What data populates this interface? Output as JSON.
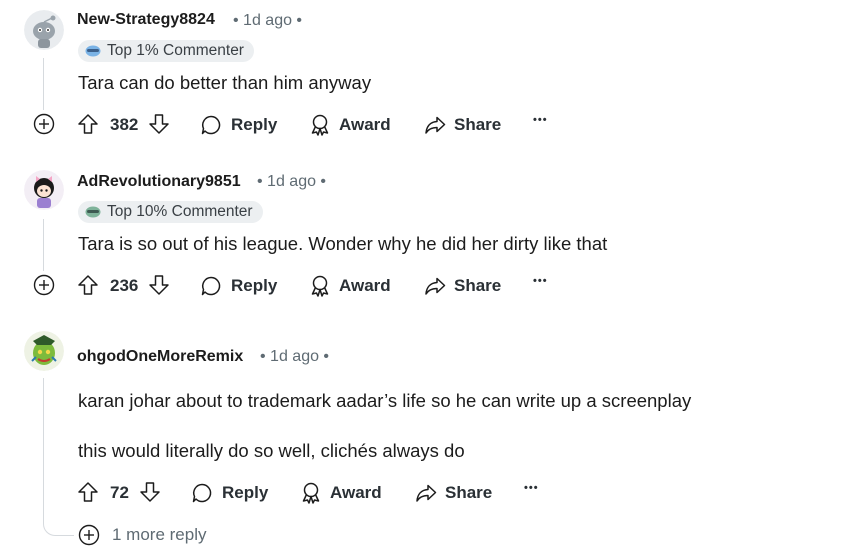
{
  "comments": [
    {
      "username": "New-Strategy8824",
      "time": "• 1d ago •",
      "badge": "Top 1% Commenter",
      "body": [
        "Tara can do better than him anyway"
      ],
      "votes": "382",
      "actions": {
        "reply": "Reply",
        "award": "Award",
        "share": "Share",
        "more": "•••"
      }
    },
    {
      "username": "AdRevolutionary9851",
      "time": "• 1d ago •",
      "badge": "Top 10% Commenter",
      "body": [
        "Tara is so out of his league. Wonder why he did her dirty like that"
      ],
      "votes": "236",
      "actions": {
        "reply": "Reply",
        "award": "Award",
        "share": "Share",
        "more": "•••"
      }
    },
    {
      "username": "ohgodOneMoreRemix",
      "time": "• 1d ago •",
      "badge": "",
      "body": [
        "karan johar about to trademark aadar’s life so he can write up a screenplay",
        "this would literally do so well, clichés always do"
      ],
      "votes": "72",
      "actions": {
        "reply": "Reply",
        "award": "Award",
        "share": "Share",
        "more": "•••"
      }
    }
  ],
  "more_replies": "1 more reply",
  "icons": {
    "upvote": "upvote-icon",
    "downvote": "downvote-icon",
    "reply": "comment-bubble-icon",
    "award": "award-ribbon-icon",
    "share": "share-arrow-icon",
    "expand": "plus-circle-icon"
  },
  "colors": {
    "badge_bg": "#eceff1",
    "thread_line": "#d6dade",
    "meta_text": "#5f6b73"
  }
}
